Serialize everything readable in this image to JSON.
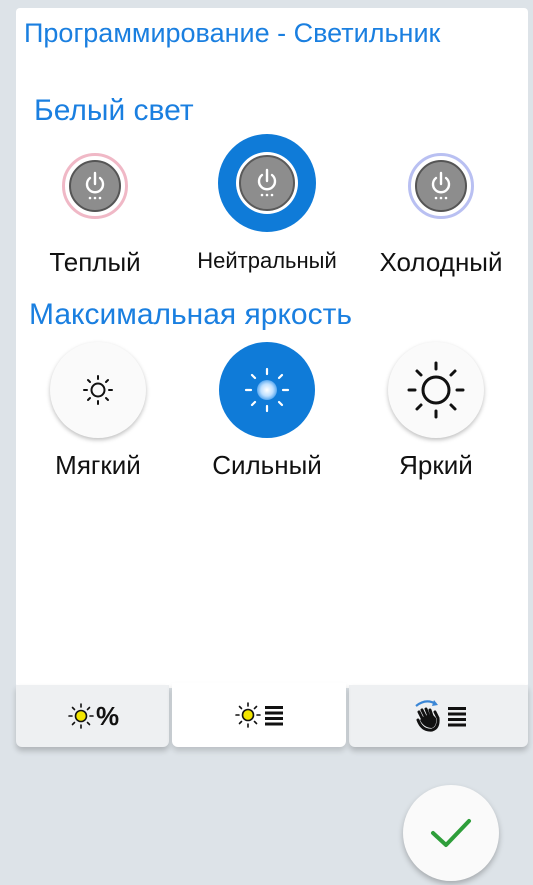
{
  "header": {
    "title": "Программирование - Светильник"
  },
  "white_light": {
    "title": "Белый свет",
    "selected": "neutral",
    "options": [
      {
        "key": "warm",
        "label": "Теплый",
        "ring_color": "#f0b8c6"
      },
      {
        "key": "neutral",
        "label": "Нейтральный",
        "ring_color": "#0f7bd8"
      },
      {
        "key": "cold",
        "label": "Холодный",
        "ring_color": "#b9c0f2"
      }
    ]
  },
  "max_brightness": {
    "title": "Максимальная яркость",
    "selected": "strong",
    "options": [
      {
        "key": "soft",
        "label": "Мягкий"
      },
      {
        "key": "strong",
        "label": "Сильный"
      },
      {
        "key": "bright",
        "label": "Яркий"
      }
    ]
  },
  "tabs": [
    {
      "key": "brightness-percent",
      "text": "%",
      "icon": "sun-icon"
    },
    {
      "key": "brightness-levels",
      "icon": "sun-list-icon",
      "active": true
    },
    {
      "key": "gesture",
      "icon": "hand-gesture-icon"
    }
  ],
  "colors": {
    "accent": "#1a7fe0",
    "selected": "#0f7bd8",
    "sun_yellow": "#f3e600",
    "confirm_check": "#2e9e3a"
  },
  "confirm_icon": "checkmark-icon"
}
